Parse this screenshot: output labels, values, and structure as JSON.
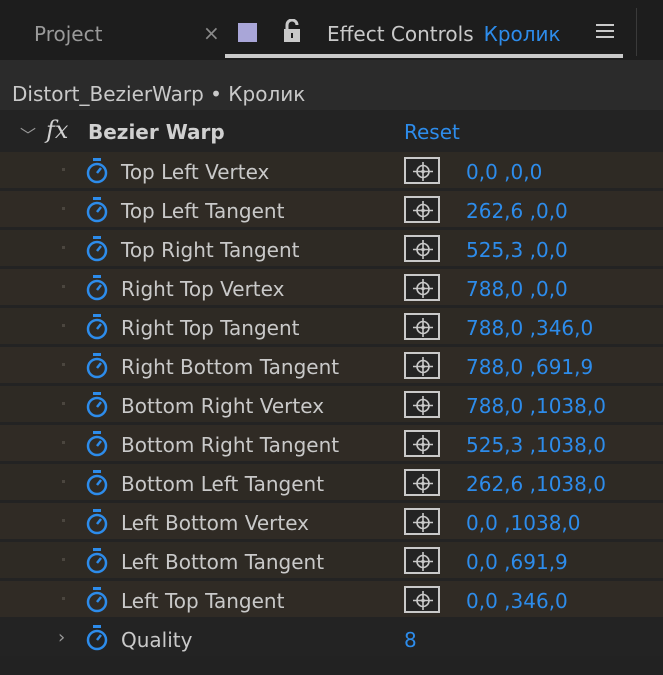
{
  "tabs": {
    "project_label": "Project",
    "close_symbol": "×",
    "effect_controls_label": "Effect Controls",
    "layer_label": "Кролик",
    "swatch_color": "#a9a6d8"
  },
  "breadcrumb": "Distort_BezierWarp • Кролик",
  "effect": {
    "fx_symbol": "fx",
    "name": "Bezier Warp",
    "reset_label": "Reset"
  },
  "properties": [
    {
      "label": "Top Left Vertex",
      "value": "0,0 ,0,0"
    },
    {
      "label": "Top Left Tangent",
      "value": "262,6 ,0,0"
    },
    {
      "label": "Top Right Tangent",
      "value": "525,3 ,0,0"
    },
    {
      "label": "Right Top Vertex",
      "value": "788,0 ,0,0"
    },
    {
      "label": "Right Top Tangent",
      "value": "788,0 ,346,0"
    },
    {
      "label": "Right Bottom Tangent",
      "value": "788,0 ,691,9"
    },
    {
      "label": "Bottom Right Vertex",
      "value": "788,0 ,1038,0"
    },
    {
      "label": "Bottom Right Tangent",
      "value": "525,3 ,1038,0"
    },
    {
      "label": "Bottom Left Tangent",
      "value": "262,6 ,1038,0"
    },
    {
      "label": "Left Bottom Vertex",
      "value": "0,0 ,1038,0"
    },
    {
      "label": "Left Bottom Tangent",
      "value": "0,0 ,691,9"
    },
    {
      "label": "Left Top Tangent",
      "value": "0,0 ,346,0"
    }
  ],
  "quality": {
    "label": "Quality",
    "value": "8"
  },
  "colors": {
    "accent": "#2d8ceb",
    "stopwatch": "#2d8ceb",
    "row_bg": "#2e2a24",
    "panel_bg": "#232323"
  },
  "icons": {
    "stopwatch": "stopwatch-icon",
    "point_control": "crosshair-icon",
    "lock": "lock-icon",
    "menu": "hamburger-menu-icon"
  }
}
